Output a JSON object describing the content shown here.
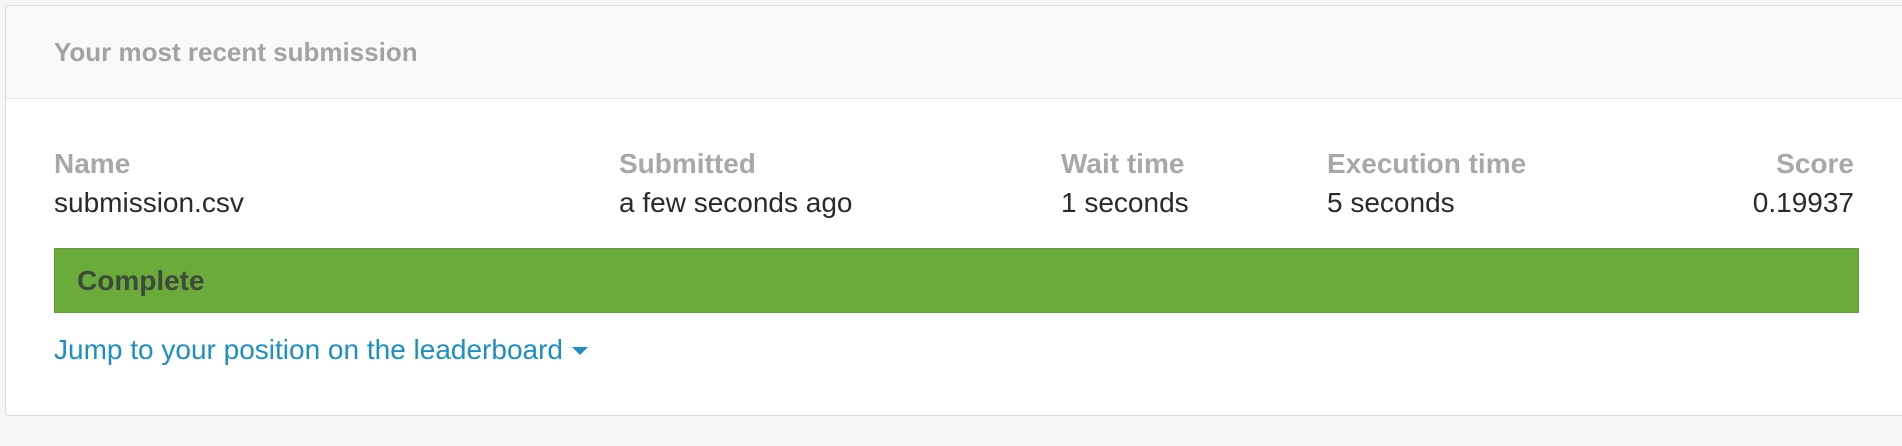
{
  "card": {
    "title": "Your most recent submission"
  },
  "columns": {
    "name": {
      "label": "Name",
      "value": "submission.csv"
    },
    "submitted": {
      "label": "Submitted",
      "value": "a few seconds ago"
    },
    "wait": {
      "label": "Wait time",
      "value": "1 seconds"
    },
    "execution": {
      "label": "Execution time",
      "value": "5 seconds"
    },
    "score": {
      "label": "Score",
      "value": "0.19937"
    }
  },
  "status": {
    "label": "Complete",
    "color": "#6aab3b"
  },
  "leaderboard_link": {
    "label": "Jump to your position on the leaderboard",
    "icon": "caret-down-icon",
    "color": "#1b8fc6"
  }
}
